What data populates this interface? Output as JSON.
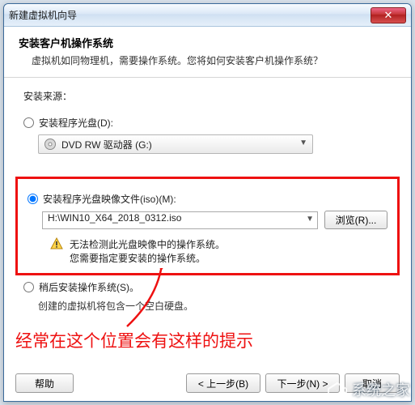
{
  "titlebar": {
    "title": "新建虚拟机向导",
    "close_glyph": "✕"
  },
  "header": {
    "title": "安装客户机操作系统",
    "subtitle": "虚拟机如同物理机，需要操作系统。您将如何安装客户机操作系统？"
  },
  "body": {
    "source_label": "安装来源：",
    "opt_disc": {
      "label": "安装程序光盘(D):",
      "drive_text": "DVD RW 驱动器 (G:)"
    },
    "opt_iso": {
      "label": "安装程序光盘映像文件(iso)(M):",
      "path": "H:\\WIN10_X64_2018_0312.iso",
      "browse": "浏览(R)...",
      "warn_line1": "无法检测此光盘映像中的操作系统。",
      "warn_line2": "您需要指定要安装的操作系统。"
    },
    "opt_later": {
      "label": "稍后安装操作系统(S)。",
      "sub": "创建的虚拟机将包含一个空白硬盘。"
    }
  },
  "footer": {
    "help": "帮助",
    "back": "< 上一步(B)",
    "next": "下一步(N) >",
    "cancel": "取消"
  },
  "annotation": "经常在这个位置会有这样的提示",
  "watermark": "系统之家"
}
